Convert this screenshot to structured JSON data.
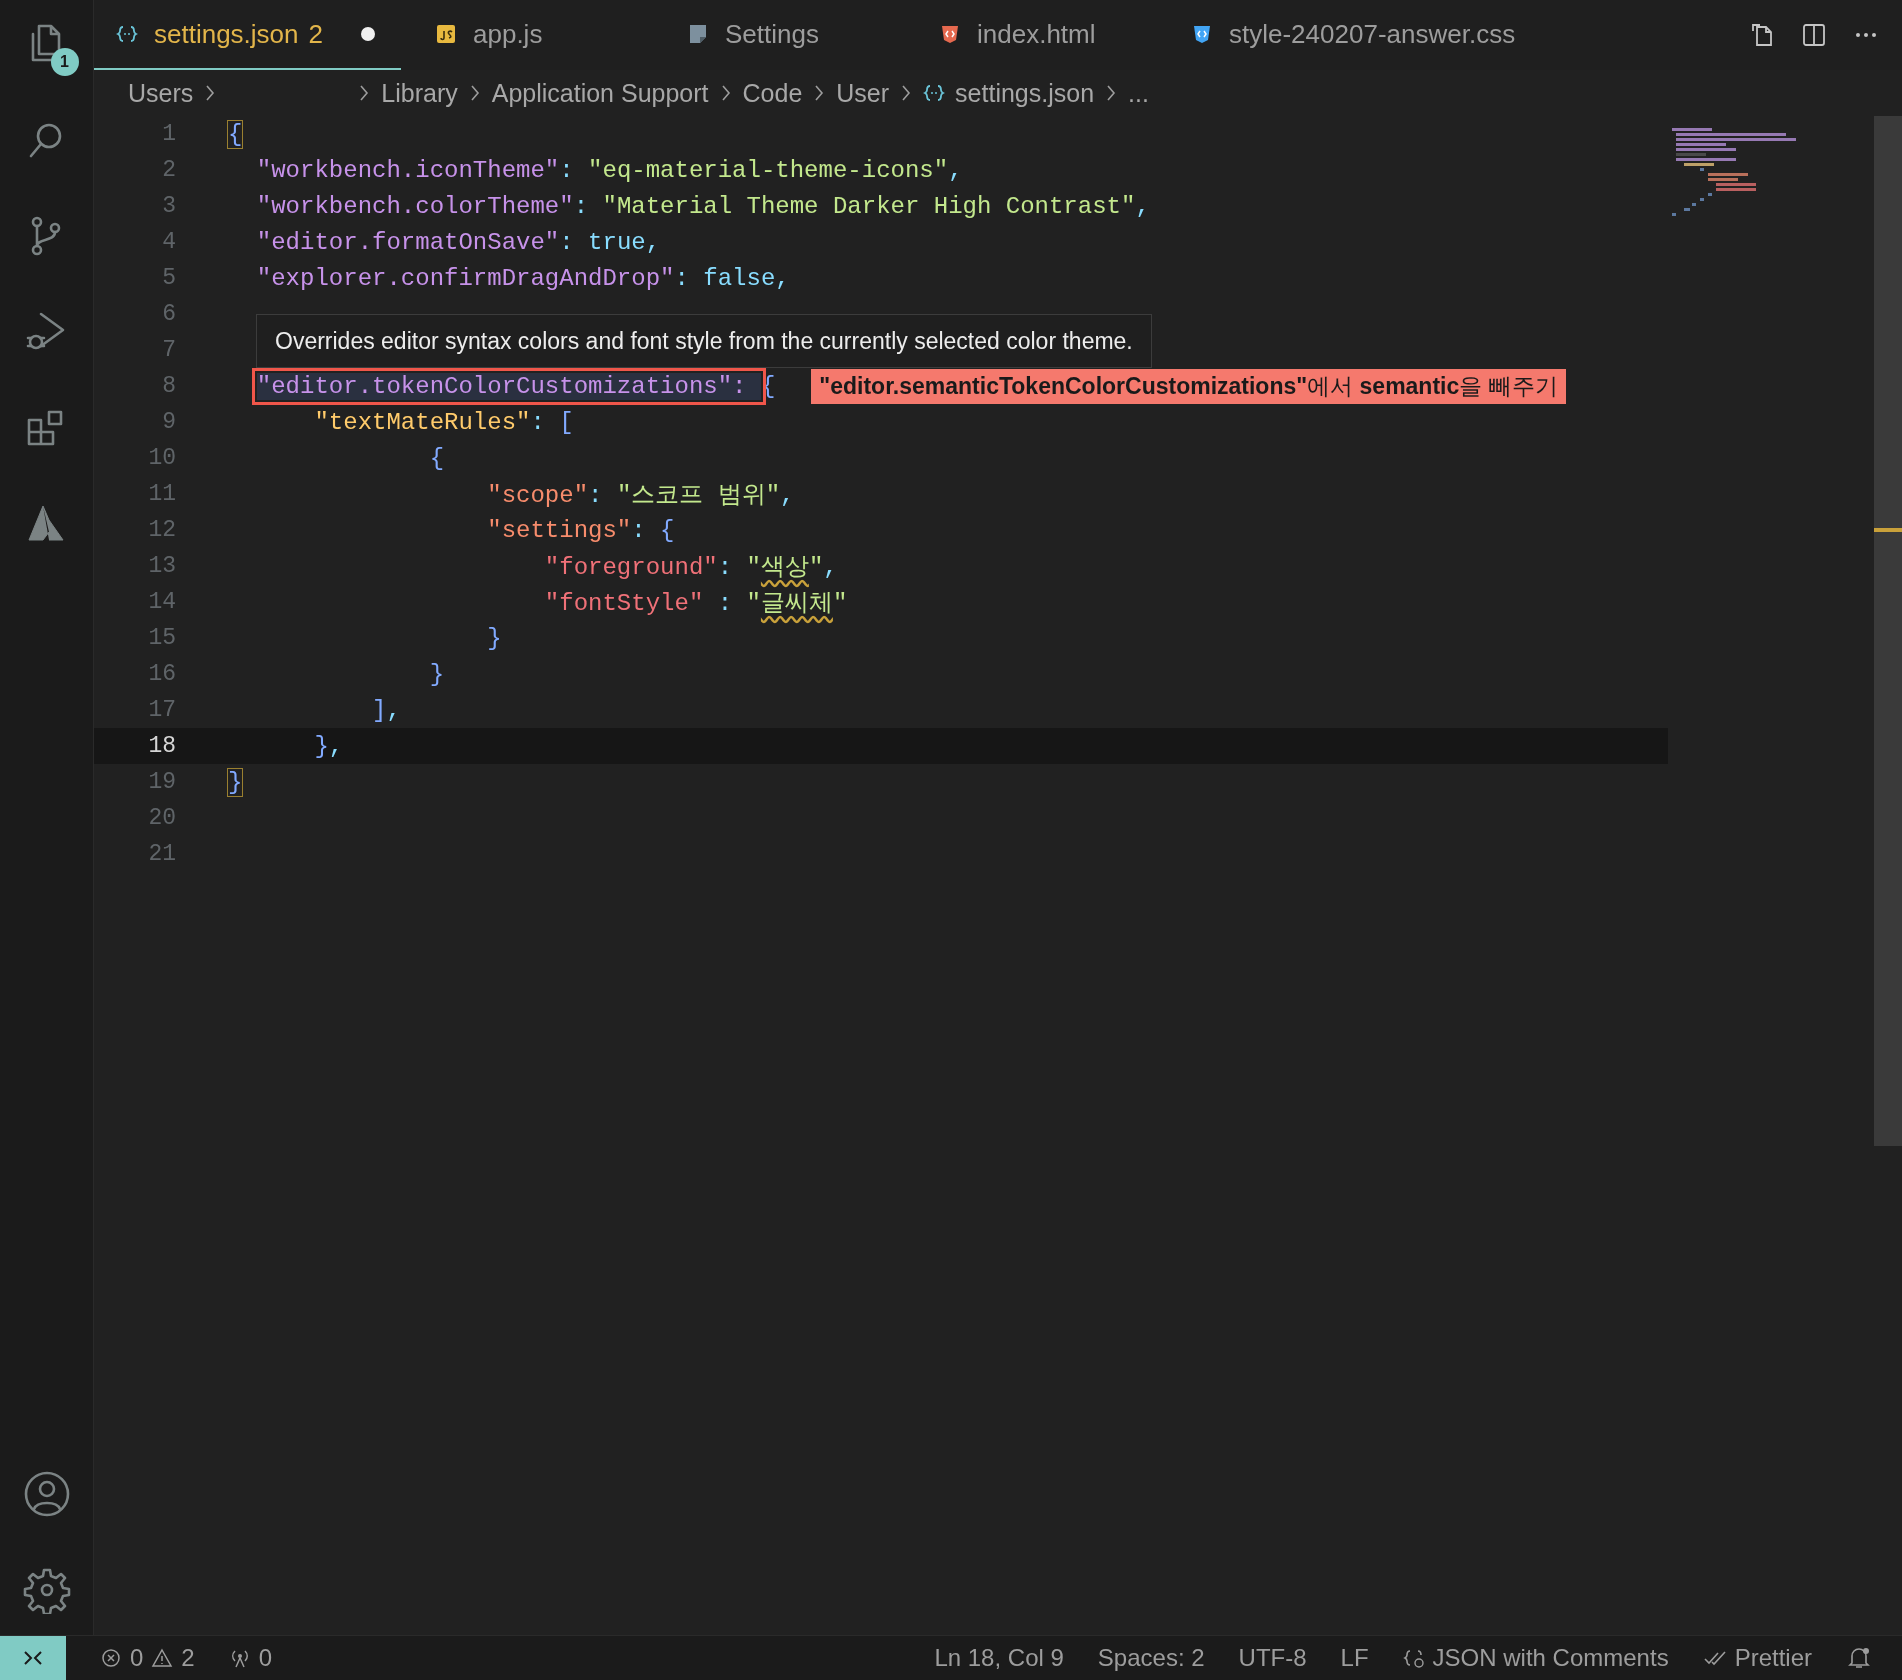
{
  "activity_bar": {
    "items": [
      {
        "kind": "explorer",
        "badge": "1"
      },
      {
        "kind": "search"
      },
      {
        "kind": "source-control"
      },
      {
        "kind": "run-debug"
      },
      {
        "kind": "extensions"
      },
      {
        "kind": "azure"
      }
    ],
    "bottom_items": [
      {
        "kind": "account"
      },
      {
        "kind": "manage"
      }
    ]
  },
  "tabs": [
    {
      "label": "settings.json",
      "kind": "json",
      "selected": true,
      "badge": "2",
      "modified": true
    },
    {
      "label": "app.js",
      "kind": "js",
      "selected": false,
      "modified": false
    },
    {
      "label": "Settings",
      "kind": "settings",
      "selected": false,
      "modified": false
    },
    {
      "label": "index.html",
      "kind": "html",
      "selected": false,
      "modified": false
    },
    {
      "label": "style-240207-answer.css",
      "kind": "css",
      "selected": false,
      "modified": false
    }
  ],
  "breadcrumb": [
    {
      "kind": "text",
      "label": "Users"
    },
    {
      "kind": "blank"
    },
    {
      "kind": "text",
      "label": "Library"
    },
    {
      "kind": "text",
      "label": "Application Support"
    },
    {
      "kind": "text",
      "label": "Code"
    },
    {
      "kind": "text",
      "label": "User"
    },
    {
      "kind": "file",
      "label": "settings.json"
    },
    {
      "kind": "text",
      "label": "..."
    }
  ],
  "editor": {
    "lines": [
      {
        "number": "1",
        "current": false,
        "tokens": [
          {
            "kind": "bracket-match",
            "text": "{"
          }
        ]
      },
      {
        "number": "2",
        "current": false,
        "tokens": [
          {
            "kind": "key-l1",
            "text": "  \"workbench.iconTheme\""
          },
          {
            "kind": "punct",
            "text": ": "
          },
          {
            "kind": "string",
            "text": "\"eq-material-theme-icons\""
          },
          {
            "kind": "punct",
            "text": ","
          }
        ]
      },
      {
        "number": "3",
        "current": false,
        "tokens": [
          {
            "kind": "key-l1",
            "text": "  \"workbench.colorTheme\""
          },
          {
            "kind": "punct",
            "text": ": "
          },
          {
            "kind": "string",
            "text": "\"Material Theme Darker High Contrast\""
          },
          {
            "kind": "punct",
            "text": ","
          }
        ]
      },
      {
        "number": "4",
        "current": false,
        "tokens": [
          {
            "kind": "key-l1",
            "text": "  \"editor.formatOnSave\""
          },
          {
            "kind": "punct",
            "text": ": "
          },
          {
            "kind": "literal",
            "text": "true"
          },
          {
            "kind": "punct",
            "text": ","
          }
        ]
      },
      {
        "number": "5",
        "current": false,
        "tokens": [
          {
            "kind": "key-l1",
            "text": "  \"explorer.confirmDragAndDrop\""
          },
          {
            "kind": "punct",
            "text": ": "
          },
          {
            "kind": "literal",
            "text": "false"
          },
          {
            "kind": "punct",
            "text": ","
          }
        ]
      },
      {
        "number": "6",
        "current": false
      },
      {
        "number": "7",
        "current": false
      },
      {
        "number": "8",
        "current": false,
        "tokens": [
          {
            "kind": "key-boxed",
            "text": "  \"editor.tokenColorCustomizations\": "
          },
          {
            "kind": "bracket",
            "text": "{"
          }
        ],
        "note": "**\"editor.semanticTokenColorCustomizations\"**에서 **semantic**을 빼주기"
      },
      {
        "number": "9",
        "current": false,
        "tokens": [
          {
            "kind": "key-l2",
            "text": "      \"textMateRules\""
          },
          {
            "kind": "punct",
            "text": ": "
          },
          {
            "kind": "bracket",
            "text": "["
          }
        ]
      },
      {
        "number": "10",
        "current": false,
        "tokens": [
          {
            "kind": "bracket",
            "text": "              {"
          }
        ]
      },
      {
        "number": "11",
        "current": false,
        "tokens": [
          {
            "kind": "key-l3",
            "text": "                  \"scope\""
          },
          {
            "kind": "punct",
            "text": ": "
          },
          {
            "kind": "string",
            "text": "\"스코프 범위\""
          },
          {
            "kind": "punct",
            "text": ","
          }
        ]
      },
      {
        "number": "12",
        "current": false,
        "tokens": [
          {
            "kind": "key-l3",
            "text": "                  \"settings\""
          },
          {
            "kind": "punct",
            "text": ": "
          },
          {
            "kind": "bracket",
            "text": "{"
          }
        ]
      },
      {
        "number": "13",
        "current": false,
        "tokens": [
          {
            "kind": "key-l4",
            "text": "                      \"foreground\""
          },
          {
            "kind": "punct",
            "text": ": "
          },
          {
            "kind": "string",
            "text": "\""
          },
          {
            "kind": "string-warn",
            "text": "색상"
          },
          {
            "kind": "string",
            "text": "\""
          },
          {
            "kind": "punct",
            "text": ","
          }
        ]
      },
      {
        "number": "14",
        "current": false,
        "tokens": [
          {
            "kind": "key-l4",
            "text": "                      \"fontStyle\""
          },
          {
            "kind": "punct",
            "text": " : "
          },
          {
            "kind": "string",
            "text": "\""
          },
          {
            "kind": "string-warn",
            "text": "글씨체"
          },
          {
            "kind": "string",
            "text": "\""
          }
        ]
      },
      {
        "number": "15",
        "current": false,
        "tokens": [
          {
            "kind": "bracket",
            "text": "                  }"
          }
        ]
      },
      {
        "number": "16",
        "current": false,
        "tokens": [
          {
            "kind": "bracket",
            "text": "              }"
          }
        ]
      },
      {
        "number": "17",
        "current": false,
        "tokens": [
          {
            "kind": "bracket",
            "text": "          ]"
          },
          {
            "kind": "punct",
            "text": ","
          }
        ]
      },
      {
        "number": "18",
        "current": true,
        "tokens": [
          {
            "kind": "bracket",
            "text": "      }"
          },
          {
            "kind": "punct",
            "text": ","
          }
        ]
      },
      {
        "number": "19",
        "current": false,
        "tokens": [
          {
            "kind": "bracket-match",
            "text": "}"
          }
        ]
      },
      {
        "number": "20",
        "current": false
      },
      {
        "number": "21",
        "current": false
      }
    ],
    "tooltip": "Overrides editor syntax colors and font style from the currently selected color theme."
  },
  "status_bar": {
    "errors": "0",
    "warnings": "2",
    "ports": "0",
    "items": [
      {
        "kind": "text",
        "label": "Ln 18, Col 9"
      },
      {
        "kind": "text",
        "label": "Spaces: 2"
      },
      {
        "kind": "text",
        "label": "UTF-8"
      },
      {
        "kind": "text",
        "label": "LF"
      },
      {
        "kind": "language",
        "label": "JSON with Comments"
      },
      {
        "kind": "formatter",
        "label": "Prettier"
      }
    ]
  }
}
